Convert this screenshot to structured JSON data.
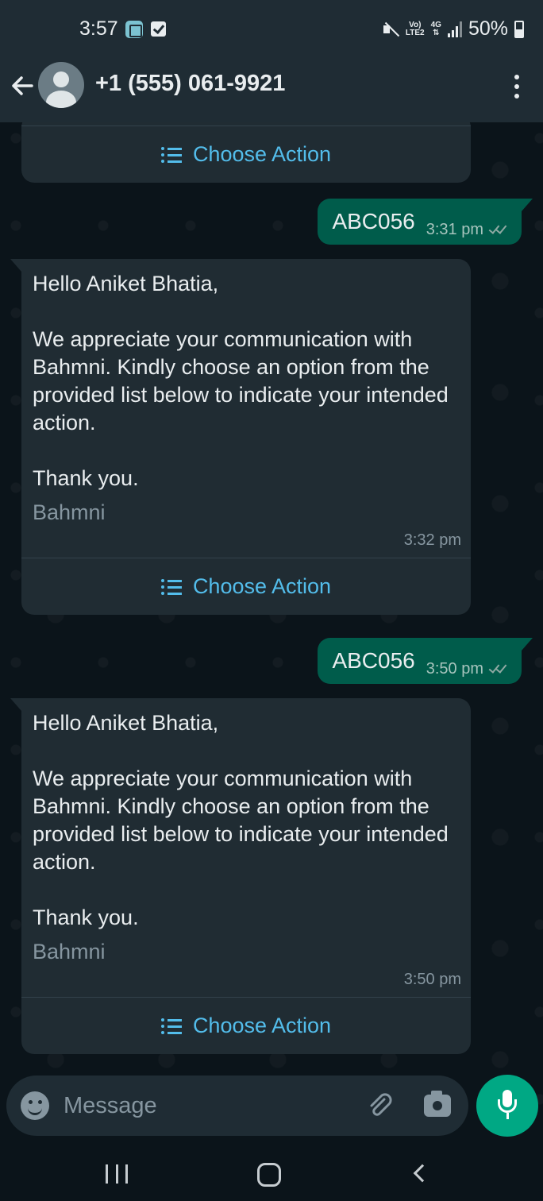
{
  "status_bar": {
    "time": "3:57",
    "network_top": "Vo)",
    "network_bottom": "LTE2",
    "network_type": "4G",
    "battery": "50%"
  },
  "header": {
    "contact_name": "+1 (555) 061-9921"
  },
  "messages": [
    {
      "type": "incoming-partial",
      "action_label": "Choose Action"
    },
    {
      "type": "outgoing",
      "text": "ABC056",
      "time": "3:31 pm"
    },
    {
      "type": "incoming",
      "greeting": "Hello Aniket Bhatia,",
      "body": "We appreciate your communication with Bahmni. Kindly choose an option from the provided list below to indicate your intended action.",
      "closing": "Thank you.",
      "footer": "Bahmni",
      "time": "3:32 pm",
      "action_label": "Choose Action"
    },
    {
      "type": "outgoing",
      "text": "ABC056",
      "time": "3:50 pm"
    },
    {
      "type": "incoming",
      "greeting": "Hello Aniket Bhatia,",
      "body": "We appreciate your communication with Bahmni. Kindly choose an option from the provided list below to indicate your intended action.",
      "closing": "Thank you.",
      "footer": "Bahmni",
      "time": "3:50 pm",
      "action_label": "Choose Action"
    }
  ],
  "input": {
    "placeholder": "Message",
    "value": ""
  },
  "colors": {
    "incoming_bubble": "#202c33",
    "outgoing_bubble": "#005c4b",
    "action_link": "#53bdeb",
    "mic_button": "#00a884"
  }
}
